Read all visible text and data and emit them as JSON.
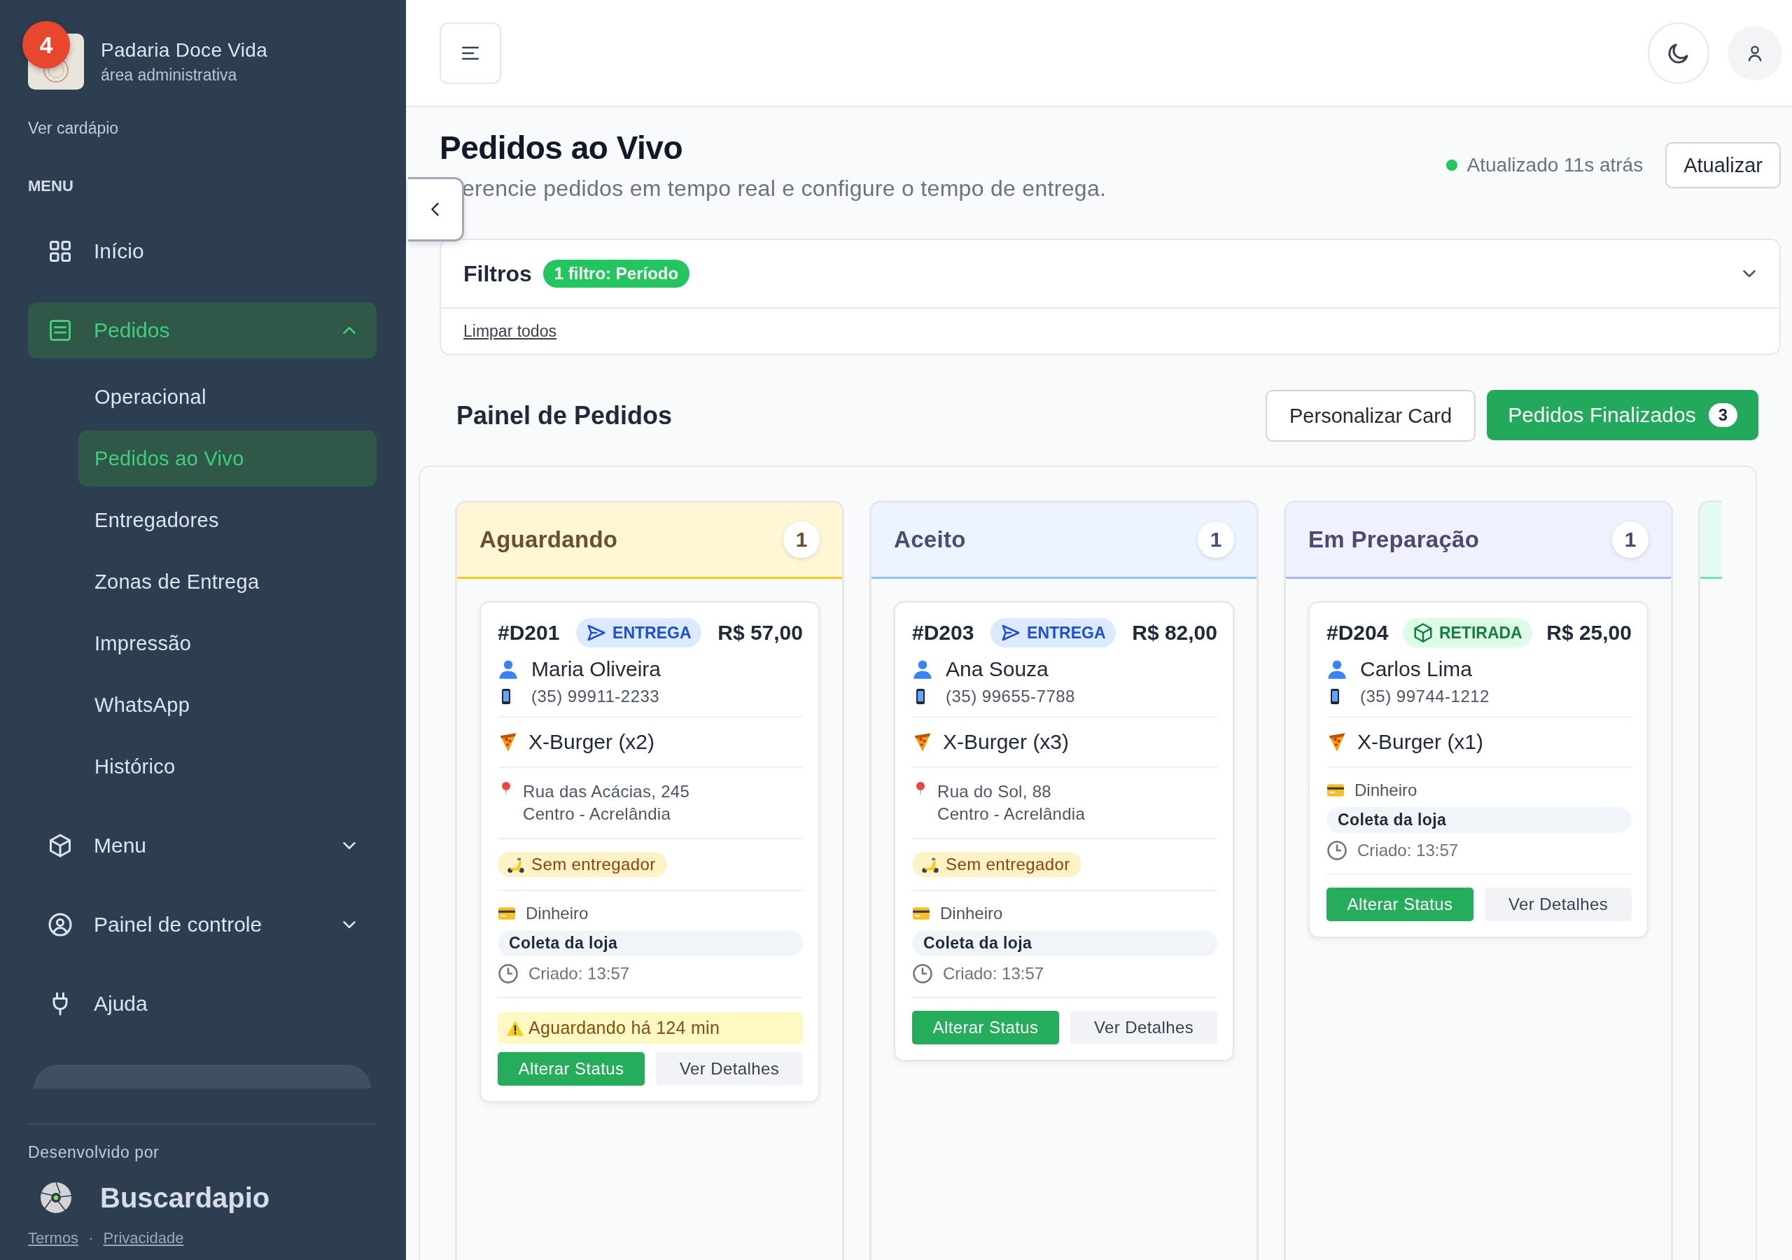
{
  "sidebar": {
    "brand": {
      "name": "Padaria Doce Vida",
      "subtitle": "área administrativa",
      "badge": "4"
    },
    "menu_link": "Ver cardápio",
    "section_label": "MENU",
    "items": [
      {
        "label": "Início",
        "selected": false
      },
      {
        "label": "Pedidos",
        "selected": true,
        "expanded": true,
        "children": [
          {
            "label": "Operacional",
            "selected": false
          },
          {
            "label": "Pedidos ao Vivo",
            "selected": true
          },
          {
            "label": "Entregadores",
            "selected": false
          },
          {
            "label": "Zonas de Entrega",
            "selected": false
          },
          {
            "label": "Impressão",
            "selected": false
          },
          {
            "label": "WhatsApp",
            "selected": false
          },
          {
            "label": "Histórico",
            "selected": false
          }
        ]
      },
      {
        "label": "Menu",
        "selected": false,
        "expanded": false
      },
      {
        "label": "Painel de controle",
        "selected": false,
        "expanded": false
      },
      {
        "label": "Ajuda",
        "selected": false
      }
    ],
    "footer": {
      "credit": "Desenvolvido por",
      "brand": "Buscardapio",
      "links": [
        "Termos",
        "Privacidade"
      ],
      "separator": "·"
    }
  },
  "page": {
    "title": "Pedidos ao Vivo",
    "subtitle": "erencie pedidos em tempo real e configure o tempo de entrega.",
    "updated": "Atualizado 11s atrás",
    "refresh_button": "Atualizar"
  },
  "filters": {
    "title": "Filtros",
    "badge": "1 filtro: Período",
    "expanded": false,
    "clear_link": "Limpar todos"
  },
  "board": {
    "title": "Painel de Pedidos",
    "customize_button": "Personalizar Card",
    "finished_button": {
      "label": "Pedidos Finalizados",
      "count": "3"
    },
    "columns": [
      {
        "title": "Aguardando",
        "count": "1",
        "color": "#facc15",
        "orders": [
          {
            "id": "#D201",
            "type": {
              "kind": "delivery",
              "label": "ENTREGA"
            },
            "price": "R$ 57,00",
            "customer": "Maria Oliveira",
            "phone": "(35) 99911-2233",
            "items": [
              "X-Burger (x2)"
            ],
            "address": [
              "Rua das Acácias, 245",
              "Centro - Acrelândia"
            ],
            "courier": "Sem entregador",
            "payment": "Dinheiro",
            "fulfillment": "Coleta da loja",
            "created": "Criado: 13:57",
            "alert": "Aguardando há 124 min",
            "actions": [
              {
                "label": "Alterar Status",
                "kind": "primary"
              },
              {
                "label": "Ver Detalhes",
                "kind": "secondary"
              }
            ]
          }
        ]
      },
      {
        "title": "Aceito",
        "count": "1",
        "color": "#93c5fd",
        "orders": [
          {
            "id": "#D203",
            "type": {
              "kind": "delivery",
              "label": "ENTREGA"
            },
            "price": "R$ 82,00",
            "customer": "Ana Souza",
            "phone": "(35) 99655-7788",
            "items": [
              "X-Burger (x3)"
            ],
            "address": [
              "Rua do Sol, 88",
              "Centro - Acrelândia"
            ],
            "courier": "Sem entregador",
            "payment": "Dinheiro",
            "fulfillment": "Coleta da loja",
            "created": "Criado: 13:57",
            "actions": [
              {
                "label": "Alterar Status",
                "kind": "primary"
              },
              {
                "label": "Ver Detalhes",
                "kind": "secondary"
              }
            ]
          }
        ]
      },
      {
        "title": "Em Preparação",
        "count": "1",
        "color": "#a5b4fc",
        "orders": [
          {
            "id": "#D204",
            "type": {
              "kind": "pickup",
              "label": "RETIRADA"
            },
            "price": "R$ 25,00",
            "customer": "Carlos Lima",
            "phone": "(35) 99744-1212",
            "items": [
              "X-Burger (x1)"
            ],
            "payment": "Dinheiro",
            "fulfillment": "Coleta da loja",
            "created": "Criado: 13:57",
            "actions": [
              {
                "label": "Alterar Status",
                "kind": "primary"
              },
              {
                "label": "Ver Detalhes",
                "kind": "secondary"
              }
            ]
          }
        ]
      },
      {
        "color": "#6ee7b7"
      }
    ]
  }
}
